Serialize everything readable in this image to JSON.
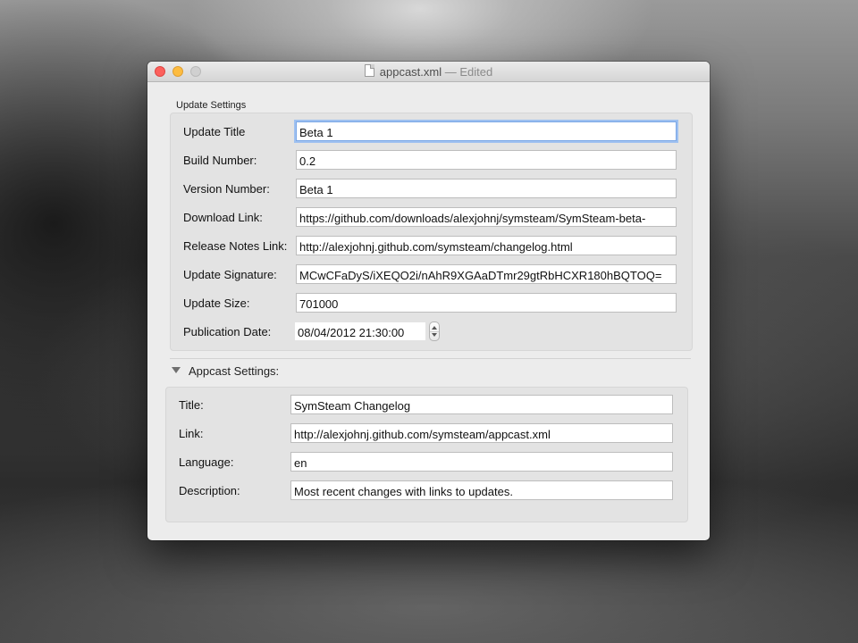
{
  "window": {
    "title": "appcast.xml",
    "separator": "—",
    "status": "Edited"
  },
  "update_settings": {
    "section_label": "Update Settings",
    "fields": [
      {
        "label": "Update Title",
        "value": "Beta 1"
      },
      {
        "label": "Build Number:",
        "value": "0.2"
      },
      {
        "label": "Version Number:",
        "value": "Beta 1"
      },
      {
        "label": "Download Link:",
        "value": "https://github.com/downloads/alexjohnj/symsteam/SymSteam-beta-"
      },
      {
        "label": "Release Notes Link:",
        "value": "http://alexjohnj.github.com/symsteam/changelog.html"
      },
      {
        "label": "Update Signature:",
        "value": "MCwCFaDyS/iXEQO2i/nAhR9XGAaDTmr29gtRbHCXR180hBQTOQ="
      },
      {
        "label": "Update Size:",
        "value": "701000"
      },
      {
        "label": "Publication Date:",
        "value": "08/04/2012 21:30:00"
      }
    ]
  },
  "appcast_settings": {
    "section_label": "Appcast Settings:",
    "fields": [
      {
        "label": "Title:",
        "value": "SymSteam Changelog"
      },
      {
        "label": "Link:",
        "value": "http://alexjohnj.github.com/symsteam/appcast.xml"
      },
      {
        "label": "Language:",
        "value": "en"
      },
      {
        "label": "Description:",
        "value": "Most recent changes with links to updates."
      }
    ]
  },
  "icons": {
    "document": "document-icon",
    "disclosure": "disclosure-triangle-icon",
    "stepper_up": "chevron-up-icon",
    "stepper_down": "chevron-down-icon"
  },
  "colors": {
    "close": "#fc605c",
    "minimize": "#fdbc40",
    "zoom_disabled": "#d0d0d0",
    "focus_ring": "#9fc1f0"
  }
}
